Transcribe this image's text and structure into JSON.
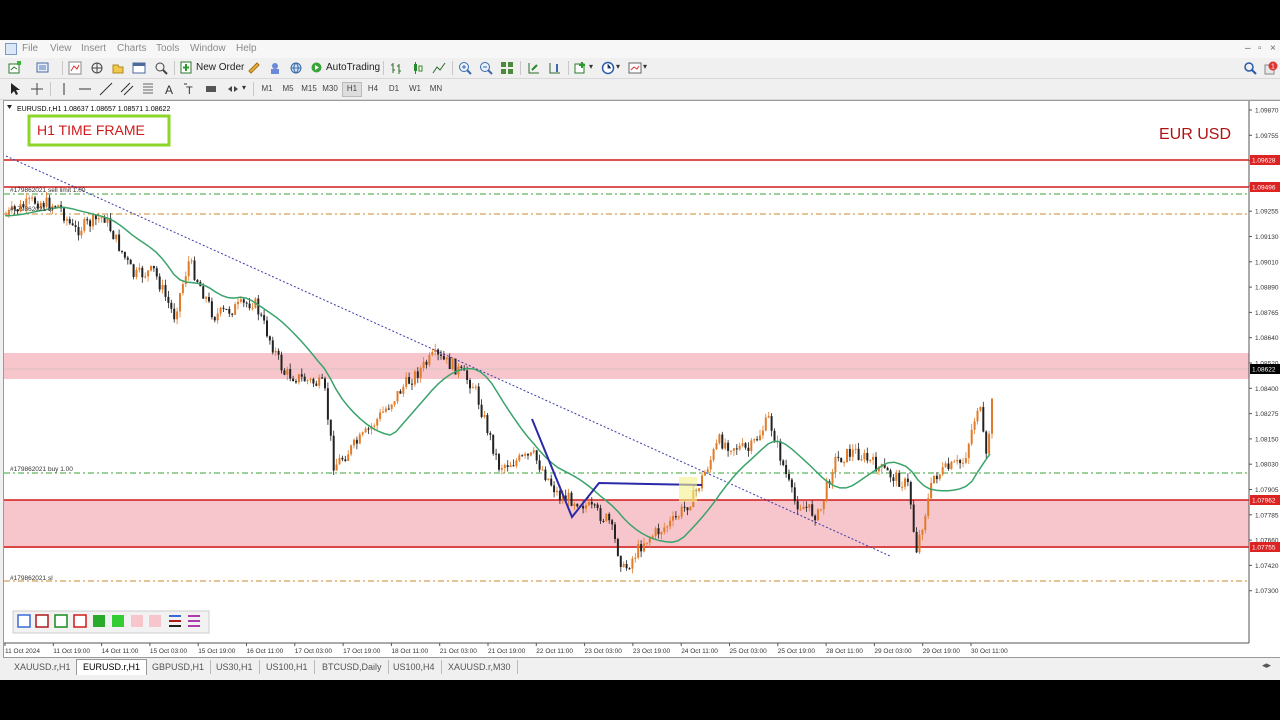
{
  "menu": [
    "File",
    "View",
    "Insert",
    "Charts",
    "Tools",
    "Window",
    "Help"
  ],
  "toolbar": {
    "new_order": "New Order",
    "autotrading": "AutoTrading"
  },
  "timeframes": [
    "M1",
    "M5",
    "M15",
    "M30",
    "H1",
    "H4",
    "D1",
    "W1",
    "MN"
  ],
  "active_timeframe": "H1",
  "chart": {
    "header": "EURUSD.r,H1  1.08637 1.08657 1.08571 1.08622",
    "label_box": "H1 TIME FRAME",
    "label_pair": "EUR USD",
    "order_labels": [
      "#179862021 sell limit 1.00",
      "#179862021 tp",
      "#179862021 buy 1.00",
      "#179862021 sl"
    ],
    "price_ticks": [
      "1.09870",
      "1.09755",
      "1.09496",
      "1.09380",
      "1.09255",
      "1.09130",
      "1.09010",
      "1.08890",
      "1.08765",
      "1.08640",
      "1.08520",
      "1.08400",
      "1.08275",
      "1.08150",
      "1.08030",
      "1.07905",
      "1.07785",
      "1.07660",
      "1.07420",
      "1.07300"
    ],
    "price_tags": [
      {
        "text": "1.09628",
        "color": "#dd2222"
      },
      {
        "text": "1.09496",
        "color": "#dd2222"
      },
      {
        "text": "1.08622",
        "color": "#000000"
      },
      {
        "text": "1.07962",
        "color": "#dd2222"
      },
      {
        "text": "1.07755",
        "color": "#dd2222"
      }
    ],
    "time_labels": [
      "11 Oct 2024",
      "11 Oct 19:00",
      "14 Oct 11:00",
      "15 Oct 03:00",
      "15 Oct 19:00",
      "16 Oct 11:00",
      "17 Oct 03:00",
      "17 Oct 19:00",
      "18 Oct 11:00",
      "21 Oct 03:00",
      "21 Oct 19:00",
      "22 Oct 11:00",
      "23 Oct 03:00",
      "23 Oct 19:00",
      "24 Oct 11:00",
      "25 Oct 03:00",
      "25 Oct 19:00",
      "28 Oct 11:00",
      "29 Oct 03:00",
      "29 Oct 19:00",
      "30 Oct 11:00"
    ],
    "colors": {
      "bull": "#e07b2a",
      "bear": "#222222",
      "ma": "#3aa36a",
      "zone": "#f7c6cc",
      "resistance": "#d11a1a",
      "trendline": "#3a3aaa",
      "pattern": "#2a2aa8"
    }
  },
  "tabs": [
    "XAUUSD.r,H1",
    "EURUSD.r,H1",
    "GBPUSD,H1",
    "US30,H1",
    "US100,H1",
    "BTCUSD,Daily",
    "US100,H4",
    "XAUUSD.r,M30"
  ],
  "active_tab": "EURUSD.r,H1"
}
